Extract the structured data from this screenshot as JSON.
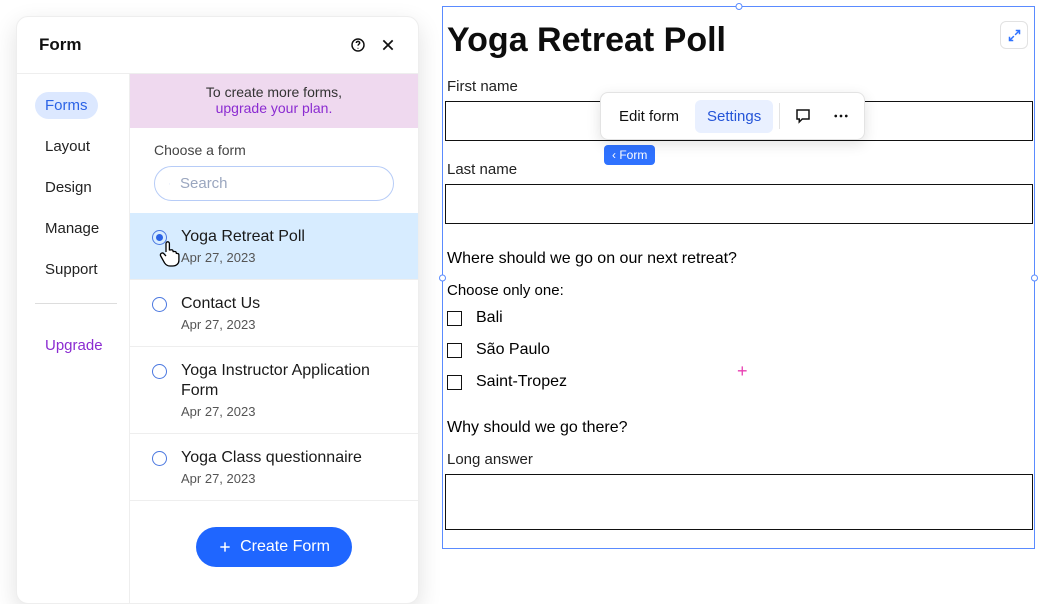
{
  "panel": {
    "title": "Form",
    "tabs": [
      "Forms",
      "Layout",
      "Design",
      "Manage",
      "Support"
    ],
    "upgrade": "Upgrade",
    "banner_line1": "To create more forms,",
    "banner_line2": "upgrade your plan.",
    "choose_label": "Choose a form",
    "search_placeholder": "Search",
    "create_label": "Create Form",
    "forms": [
      {
        "title": "Yoga Retreat Poll",
        "date": "Apr 27, 2023",
        "selected": true
      },
      {
        "title": "Contact Us",
        "date": "Apr 27, 2023",
        "selected": false
      },
      {
        "title": "Yoga Instructor Application Form",
        "date": "Apr 27, 2023",
        "selected": false
      },
      {
        "title": "Yoga Class questionnaire",
        "date": "Apr 27, 2023",
        "selected": false
      }
    ]
  },
  "toolbar": {
    "edit": "Edit form",
    "settings": "Settings"
  },
  "crumb": "Form",
  "form": {
    "title": "Yoga Retreat Poll",
    "first_name": "First name",
    "last_name": "Last name",
    "q1": "Where should we go on our next retreat?",
    "choose_one": "Choose only one:",
    "opts": [
      "Bali",
      "São Paulo",
      "Saint-Tropez"
    ],
    "q2": "Why should we go there?",
    "long": "Long answer"
  }
}
